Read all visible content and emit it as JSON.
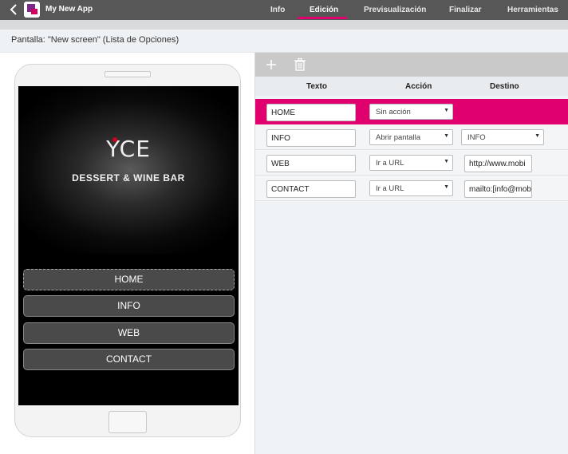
{
  "header": {
    "app_title": "My New App",
    "tabs": [
      {
        "label": "Info"
      },
      {
        "label": "Edición"
      },
      {
        "label": "Previsualización"
      },
      {
        "label": "Finalizar"
      },
      {
        "label": "Herramientas"
      }
    ],
    "active_tab": "Edición",
    "accent_color": "#e0006e"
  },
  "screen_bar": {
    "label": "Pantalla: \"New screen\" (Lista de Opciones)"
  },
  "preview": {
    "logo_text": "YCE",
    "subtitle": "DESSERT & WINE BAR",
    "buttons": [
      "HOME",
      "INFO",
      "WEB",
      "CONTACT"
    ]
  },
  "editor": {
    "toolbar": {
      "add_icon": "plus-icon",
      "delete_icon": "trash-icon"
    },
    "columns": {
      "text": "Texto",
      "action": "Acción",
      "destination": "Destino"
    },
    "rows": [
      {
        "text": "HOME",
        "action": "Sin acción",
        "destination": ""
      },
      {
        "text": "INFO",
        "action": "Abrir pantalla",
        "destination": "INFO"
      },
      {
        "text": "WEB",
        "action": "Ir a URL",
        "destination": "http://www.mobi"
      },
      {
        "text": "CONTACT",
        "action": "Ir a URL",
        "destination": "mailto:[info@mob"
      }
    ]
  }
}
